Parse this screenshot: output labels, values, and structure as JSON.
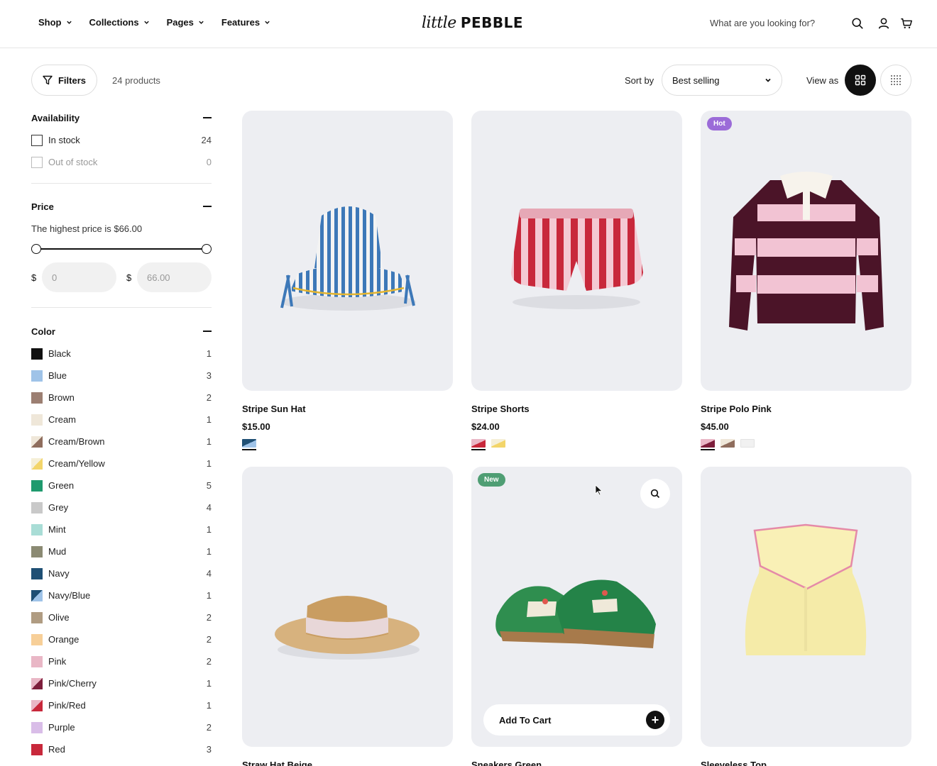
{
  "header": {
    "nav": [
      {
        "label": "Shop"
      },
      {
        "label": "Collections"
      },
      {
        "label": "Pages"
      },
      {
        "label": "Features"
      }
    ],
    "logo_script": "little",
    "logo_bold": "PEBBLE",
    "search_placeholder": "What are you looking for?",
    "icons": [
      "search-icon",
      "account-icon",
      "cart-icon"
    ]
  },
  "toolbar": {
    "filters_label": "Filters",
    "product_count": "24 products",
    "sort_label": "Sort by",
    "sort_value": "Best selling",
    "view_label": "View as"
  },
  "filters": {
    "availability": {
      "title": "Availability",
      "options": [
        {
          "label": "In stock",
          "count": "24",
          "disabled": false
        },
        {
          "label": "Out of stock",
          "count": "0",
          "disabled": true
        }
      ]
    },
    "price": {
      "title": "Price",
      "note": "The highest price is $66.00",
      "currency": "$",
      "min_placeholder": "0",
      "max_placeholder": "66.00",
      "range_fraction": [
        0,
        1
      ]
    },
    "color": {
      "title": "Color",
      "options": [
        {
          "label": "Black",
          "count": "1",
          "color": "#111111"
        },
        {
          "label": "Blue",
          "count": "3",
          "color": "#9fc3e8"
        },
        {
          "label": "Brown",
          "count": "2",
          "color": "#9c7f72"
        },
        {
          "label": "Cream",
          "count": "1",
          "color": "#efe7d9"
        },
        {
          "label": "Cream/Brown",
          "count": "1",
          "color": "#efe7d9",
          "color2": "#8f6d5d"
        },
        {
          "label": "Cream/Yellow",
          "count": "1",
          "color": "#f5efd7",
          "color2": "#f3d56a"
        },
        {
          "label": "Green",
          "count": "5",
          "color": "#1f9a6e"
        },
        {
          "label": "Grey",
          "count": "4",
          "color": "#c9c9c9"
        },
        {
          "label": "Mint",
          "count": "1",
          "color": "#a9ddd6"
        },
        {
          "label": "Mud",
          "count": "1",
          "color": "#8b8a73"
        },
        {
          "label": "Navy",
          "count": "4",
          "color": "#1f4f74"
        },
        {
          "label": "Navy/Blue",
          "count": "1",
          "color": "#1f4f74",
          "color2": "#9fc3e8"
        },
        {
          "label": "Olive",
          "count": "2",
          "color": "#b09c82"
        },
        {
          "label": "Orange",
          "count": "2",
          "color": "#f7cf98"
        },
        {
          "label": "Pink",
          "count": "2",
          "color": "#e9b7c6"
        },
        {
          "label": "Pink/Cherry",
          "count": "1",
          "color": "#e9b7c6",
          "color2": "#7d1f3c"
        },
        {
          "label": "Pink/Red",
          "count": "1",
          "color": "#e9b7c6",
          "color2": "#c8283b"
        },
        {
          "label": "Purple",
          "count": "2",
          "color": "#d9bde8"
        },
        {
          "label": "Red",
          "count": "3",
          "color": "#c8283b"
        }
      ]
    }
  },
  "products": [
    {
      "title": "Stripe Sun Hat",
      "price": "$15.00",
      "badge": "",
      "image": "bucket-hat-image",
      "swatches": [
        {
          "c1": "#1f4f74",
          "c2": "#9fc3e8"
        }
      ]
    },
    {
      "title": "Stripe Shorts",
      "price": "$24.00",
      "badge": "",
      "image": "shorts-image",
      "swatches": [
        {
          "c1": "#e9b7c6",
          "c2": "#c8283b"
        },
        {
          "c1": "#f5efd7",
          "c2": "#f3d56a"
        }
      ]
    },
    {
      "title": "Stripe Polo Pink",
      "price": "$45.00",
      "badge": "Hot",
      "badge_color": "#9b6bd8",
      "image": "polo-image",
      "swatches": [
        {
          "c1": "#e9b7c6",
          "c2": "#7d1f3c"
        },
        {
          "c1": "#efe7d9",
          "c2": "#8f6d5d"
        },
        {
          "c1": "#f1f1f1",
          "c2": "#f1f1f1"
        }
      ]
    },
    {
      "title": "Straw Hat Beige",
      "price": "",
      "badge": "",
      "image": "straw-hat-image",
      "swatches": []
    },
    {
      "title": "Sneakers Green",
      "price": "",
      "badge": "New",
      "badge_color": "#4f9e74",
      "image": "sneakers-image",
      "add_to_cart": "Add To Cart",
      "swatches": []
    },
    {
      "title": "Sleeveless Top",
      "price": "",
      "badge": "",
      "image": "sleeveless-top-image",
      "swatches": []
    }
  ]
}
